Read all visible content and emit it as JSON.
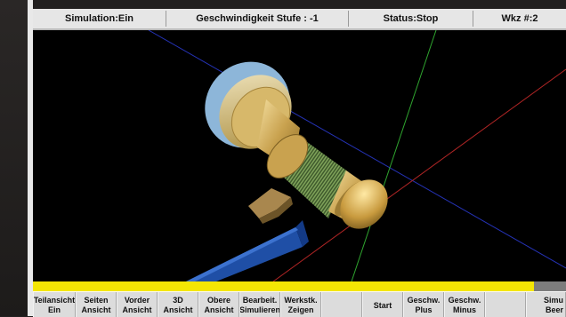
{
  "status_bar": {
    "simulation": "Simulation:Ein",
    "speed": "Geschwindigkeit Stufe : -1",
    "status": "Status:Stop",
    "tool": "Wkz #:2"
  },
  "viewport": {
    "icon": "3d-lathe-workpiece-view"
  },
  "progress": {
    "fraction": 0.94,
    "color": "#f4e604"
  },
  "softkeys": [
    {
      "line1": "Teilansicht",
      "line2": "Ein"
    },
    {
      "line1": "Seiten",
      "line2": "Ansicht"
    },
    {
      "line1": "Vorder",
      "line2": "Ansicht"
    },
    {
      "line1": "3D",
      "line2": "Ansicht"
    },
    {
      "line1": "Obere",
      "line2": "Ansicht"
    },
    {
      "line1": "Bearbeit.",
      "line2": "Simulieren"
    },
    {
      "line1": "Werkstk.",
      "line2": "Zeigen"
    },
    {
      "line1": "",
      "line2": ""
    },
    {
      "line1": "Start",
      "line2": ""
    },
    {
      "line1": "Geschw.",
      "line2": "Plus"
    },
    {
      "line1": "Geschw.",
      "line2": "Minus"
    },
    {
      "line1": "",
      "line2": ""
    },
    {
      "line1": "Simu",
      "line2": "Beer"
    }
  ]
}
